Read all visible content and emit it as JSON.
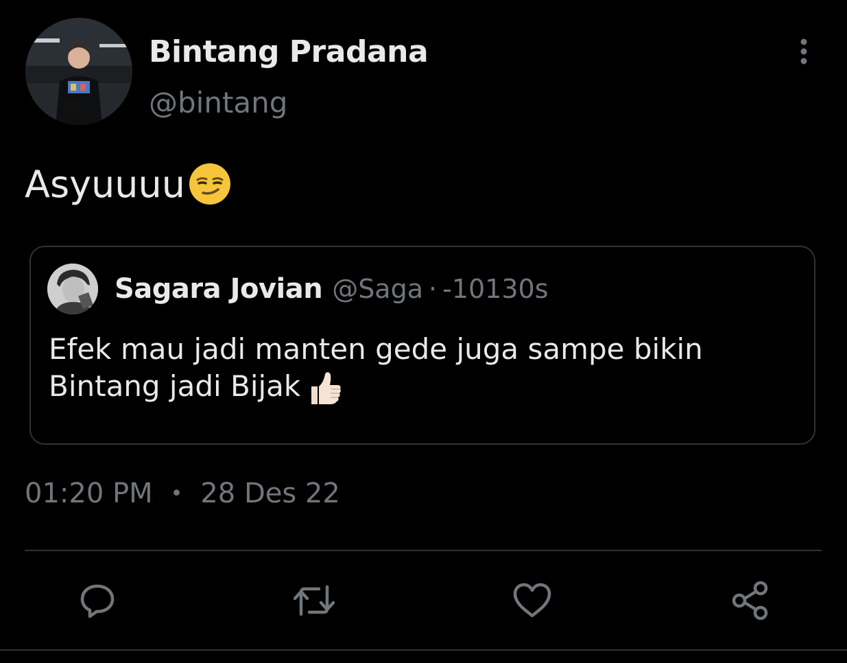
{
  "author": {
    "name": "Bintang Pradana",
    "handle": "@bintang"
  },
  "tweet": {
    "text": "Asyuuuu",
    "emoji": "smirking-face"
  },
  "quoted_tweet": {
    "name": "Sagara Jovian",
    "handle": "@Saga",
    "separator": "·",
    "time": "-10130s",
    "text": "Efek mau jadi manten gede juga sampe bikin Bintang jadi Bijak",
    "emoji": "thumbs-up"
  },
  "meta": {
    "time": "01:20 PM",
    "dot": "•",
    "date": "28 Des 22"
  },
  "actions": [
    {
      "name": "reply",
      "icon": "comment-icon"
    },
    {
      "name": "retweet",
      "icon": "retweet-icon"
    },
    {
      "name": "like",
      "icon": "heart-icon"
    },
    {
      "name": "share",
      "icon": "share-icon"
    }
  ],
  "colors": {
    "background": "#000000",
    "text": "#e7e9ea",
    "muted": "#71767b",
    "border": "#2f3336",
    "icon": "#71767b"
  }
}
